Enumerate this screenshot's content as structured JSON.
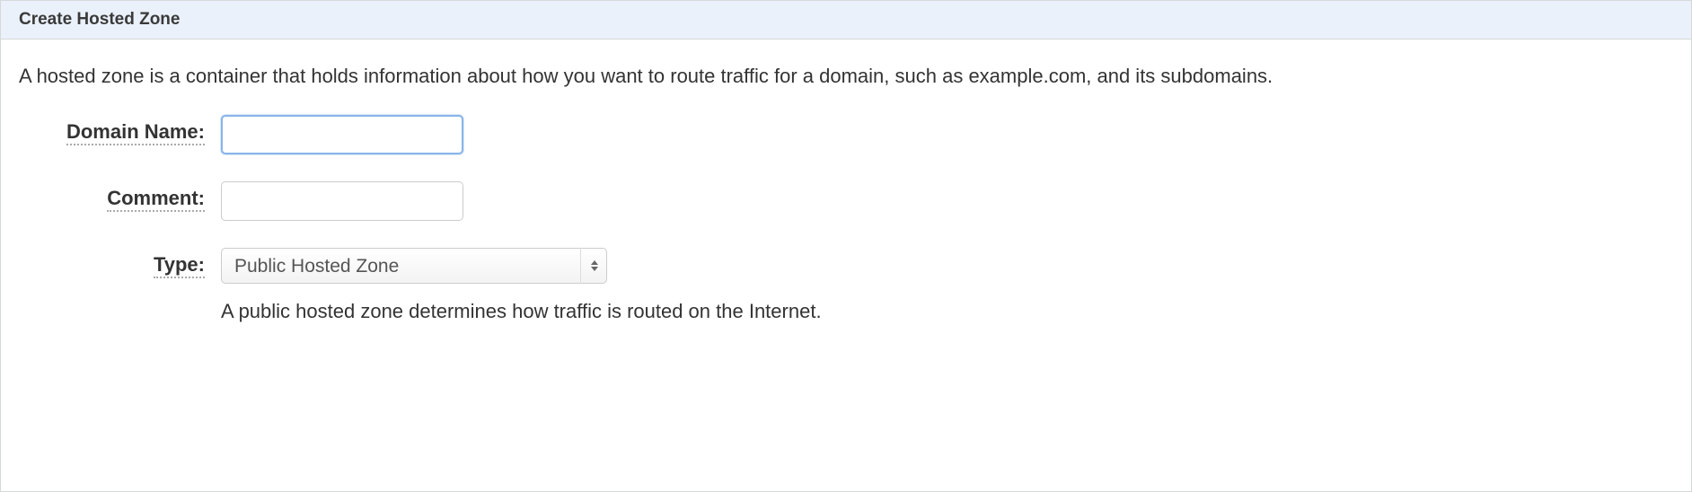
{
  "header": {
    "title": "Create Hosted Zone"
  },
  "description": "A hosted zone is a container that holds information about how you want to route traffic for a domain, such as example.com, and its subdomains.",
  "form": {
    "domain_name": {
      "label": "Domain Name:",
      "value": "",
      "placeholder": ""
    },
    "comment": {
      "label": "Comment:",
      "value": "",
      "placeholder": ""
    },
    "type": {
      "label": "Type:",
      "selected": "Public Hosted Zone",
      "help": "A public hosted zone determines how traffic is routed on the Internet."
    }
  }
}
